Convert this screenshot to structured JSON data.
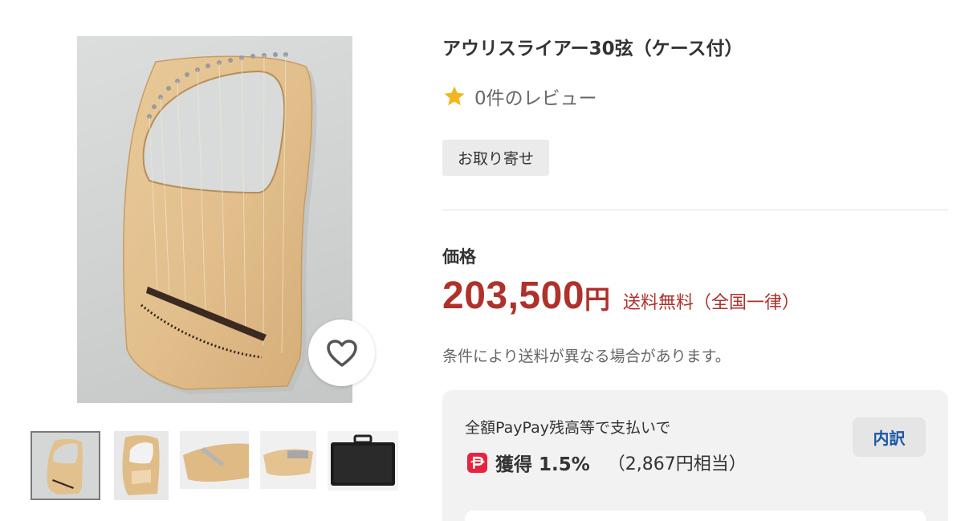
{
  "product": {
    "title": "アウリスライアー30弦（ケース付）",
    "rating_star_icon": "star-icon",
    "review_text": "0件のレビュー",
    "badge": "お取り寄せ"
  },
  "price": {
    "label": "価格",
    "amount": "203,500",
    "currency": "円",
    "shipping": "送料無料（全国一律）",
    "shipping_note": "条件により送料が異なる場合があります。"
  },
  "paypay": {
    "lead": "全額PayPay残高等で支払いで",
    "icon": "paypay-icon",
    "earn": "獲得 1.5%",
    "equivalent": "（2,867円相当）",
    "breakdown_label": "内訳"
  },
  "gallery": {
    "favorite_icon": "heart-icon",
    "thumbnails": [
      "lyre-front",
      "lyre-back",
      "lyre-side-detail",
      "lyre-side-view",
      "black-case"
    ],
    "selected_index": 0
  },
  "colors": {
    "price_red": "#b0312c",
    "star_yellow": "#f2b61f",
    "link_blue": "#1a56a8",
    "paypay_red": "#e8233d"
  }
}
